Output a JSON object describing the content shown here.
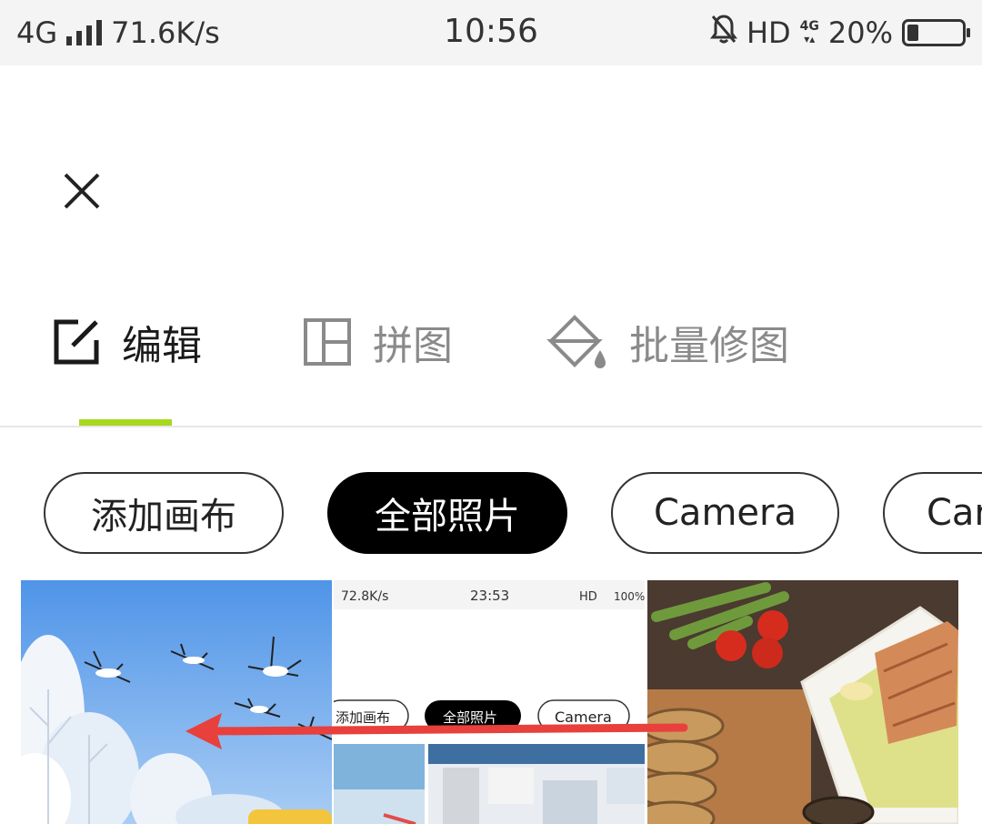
{
  "status_bar": {
    "network": "4G",
    "speed": "71.6K/s",
    "time": "10:56",
    "hd": "HD",
    "net_badge": "4G",
    "battery": "20%",
    "battery_level": 0.2
  },
  "header": {
    "close_icon": "close-icon"
  },
  "tabs": [
    {
      "label": "编辑",
      "icon": "edit-icon",
      "active": true
    },
    {
      "label": "拼图",
      "icon": "collage-icon",
      "active": false
    },
    {
      "label": "批量修图",
      "icon": "batch-edit-icon",
      "active": false
    }
  ],
  "accent_color": "#a8d81e",
  "albums": [
    {
      "label": "添加画布",
      "selected": false
    },
    {
      "label": "全部照片",
      "selected": true
    },
    {
      "label": "Camera",
      "selected": false
    },
    {
      "label": "Car",
      "selected": false
    }
  ],
  "photos": [
    {
      "subject": "cranes-flying-over-snowy-trees"
    },
    {
      "subject": "screenshot-of-app",
      "inner_speed": "72.8K/s",
      "inner_time": "23:53",
      "inner_status": "HD",
      "inner_battery": "100%",
      "inner_chip_1": "添加画布",
      "inner_chip_2": "全部照片",
      "inner_chip_3": "Camera"
    },
    {
      "subject": "salmon-bread-asparagus-tomatoes"
    }
  ]
}
